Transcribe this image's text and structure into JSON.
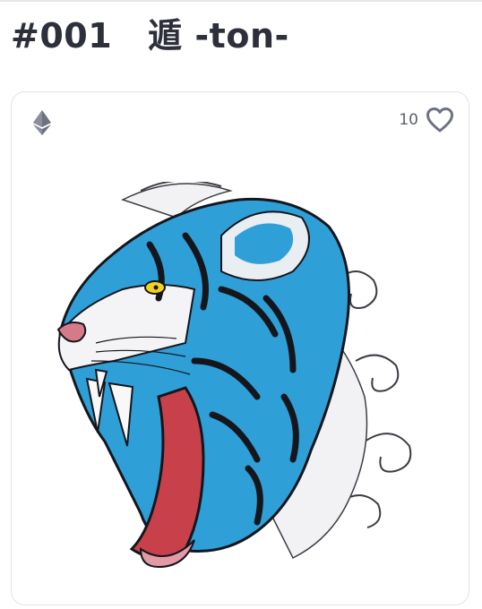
{
  "header": {
    "token_number": "#001",
    "token_name": "遁 -ton-"
  },
  "card": {
    "currency_icon": "ethereum-icon",
    "like_count": "10",
    "like_icon": "heart-outline-icon",
    "artwork_icon": "blue-tiger-illustration",
    "colors": {
      "tiger_blue": "#2f9fd8",
      "stripe": "#14161c",
      "mouth": "#c8414a",
      "eye": "#f2d21e",
      "icon_gray": "#6e7280"
    }
  }
}
